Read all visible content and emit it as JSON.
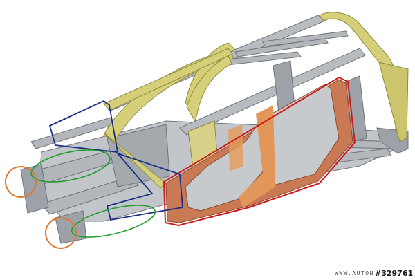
{
  "image": {
    "watermark_site": "WWW.AUTON...",
    "watermark_id": "#329761"
  },
  "colors": {
    "background": "#ffffff",
    "frame_grey": "#a9adb2",
    "frame_grey_dark": "#6f747a",
    "pillar_yellow": "#d6cf7a",
    "side_ring_copper": "#c97a55",
    "side_ring_highlight": "#e59a5a",
    "outline_red": "#d01818",
    "outline_navy": "#1b2f86",
    "ellipse_green": "#1f9e2a",
    "circle_orange": "#e0782e"
  }
}
